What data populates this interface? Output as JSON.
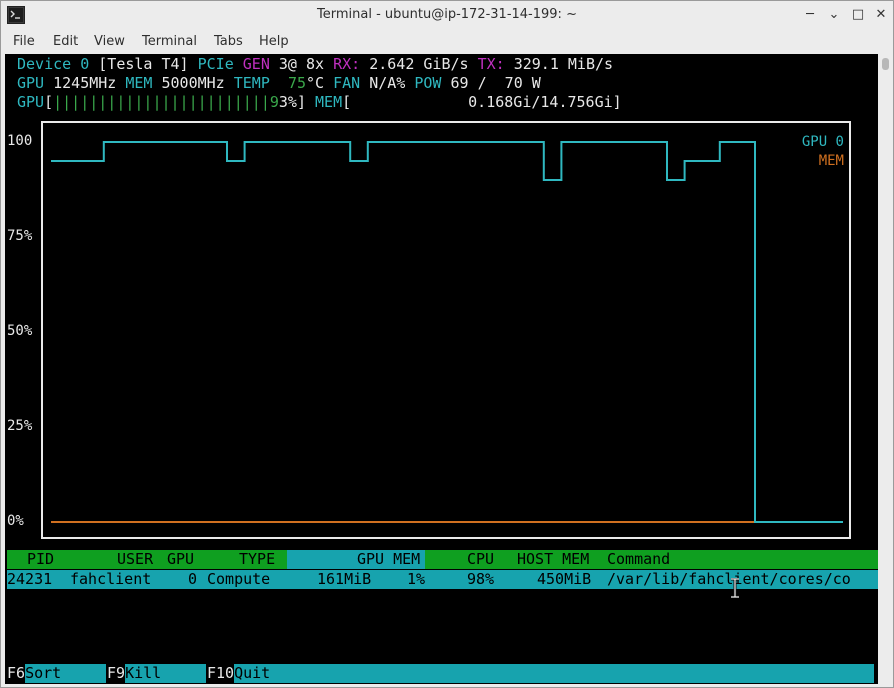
{
  "window": {
    "title": "Terminal - ubuntu@ip-172-31-14-199: ~",
    "buttons": {
      "minimize": "─",
      "restore": "⌄",
      "maximize": "□",
      "close": "✕"
    }
  },
  "menu": [
    "File",
    "Edit",
    "View",
    "Terminal",
    "Tabs",
    "Help"
  ],
  "device": {
    "device_label": "Device 0",
    "name": "[Tesla T4]",
    "pcie_label": "PCIe",
    "gen_label": "GEN",
    "gen_value": "3@ 8x",
    "rx_label": "RX:",
    "rx_value": "2.642 GiB/s",
    "tx_label": "TX:",
    "tx_value": "329.1 MiB/s",
    "gpu_label": "GPU",
    "gpu_clock": "1245MHz",
    "mem_label": "MEM",
    "mem_clock": "5000MHz",
    "temp_label": "TEMP",
    "temp_value": "75",
    "temp_unit": "°C",
    "fan_label": "FAN",
    "fan_value": "N/A%",
    "pow_label": "POW",
    "pow_value": "69 /  70 W",
    "gpu_bar_label": "GPU",
    "gpu_bar_open": "[",
    "gpu_bar_fill": "||||||||||||||||||||||||9",
    "gpu_bar_pct": "3%]",
    "gpu_util": 0.93,
    "mem_bar_label": "MEM",
    "mem_bar_open": "[",
    "mem_bar_value": "0.168Gi/14.756Gi]"
  },
  "chart_data": {
    "type": "line",
    "y_ticks": [
      "100",
      "75%",
      "50%",
      "25%",
      "0%"
    ],
    "ylim": [
      0,
      100
    ],
    "series": [
      {
        "name": "GPU 0",
        "color": "#2fb8c0",
        "values": [
          95,
          95,
          95,
          100,
          100,
          100,
          100,
          100,
          100,
          100,
          95,
          100,
          100,
          100,
          100,
          100,
          100,
          95,
          100,
          100,
          100,
          100,
          100,
          100,
          100,
          100,
          100,
          100,
          90,
          100,
          100,
          100,
          100,
          100,
          100,
          90,
          95,
          95,
          100,
          100,
          0,
          0,
          0,
          0,
          0
        ]
      },
      {
        "name": "MEM",
        "color": "#d07020",
        "values": [
          0,
          0,
          0,
          0,
          0,
          0,
          0,
          0,
          0,
          0,
          0,
          0,
          0,
          0,
          0,
          0,
          0,
          0,
          0,
          0,
          0,
          0,
          0,
          0,
          0,
          0,
          0,
          0,
          0,
          0,
          0,
          0,
          0,
          0,
          0,
          0,
          0,
          0,
          0,
          0,
          0,
          0,
          0,
          0,
          0
        ]
      }
    ]
  },
  "process_table": {
    "columns": [
      "PID",
      "USER",
      "GPU",
      "TYPE",
      "GPU MEM",
      "CPU",
      "HOST MEM",
      "Command"
    ],
    "rows": [
      {
        "pid": "24231",
        "user": "fahclient",
        "gpu": "0",
        "type": "Compute",
        "gpu_mem": "161MiB",
        "gpu_mem_pct": "1%",
        "cpu": "98%",
        "host_mem": "450MiB",
        "command": "/var/lib/fahclient/cores/co"
      }
    ]
  },
  "function_keys": [
    {
      "key": "F6",
      "label": "Sort"
    },
    {
      "key": "F9",
      "label": "Kill"
    },
    {
      "key": "F10",
      "label": "Quit"
    }
  ]
}
